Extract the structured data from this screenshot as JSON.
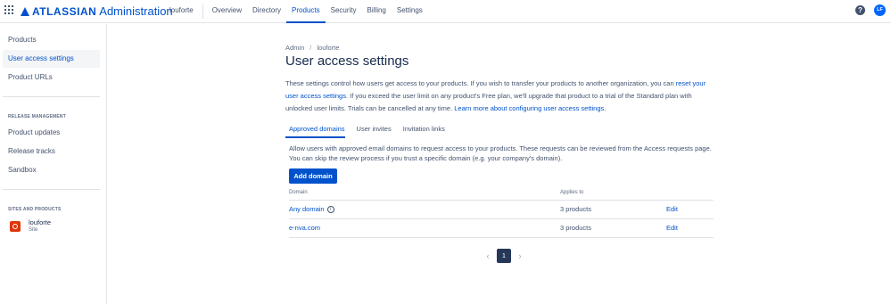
{
  "topbar": {
    "logo_word": "ATLASSIAN",
    "logo_product": "Administration",
    "org": "louforte",
    "nav": [
      "Overview",
      "Directory",
      "Products",
      "Security",
      "Billing",
      "Settings"
    ],
    "active_nav": "Products",
    "help_label": "?",
    "avatar_initials": "LF"
  },
  "sidebar": {
    "items": [
      "Products",
      "User access settings",
      "Product URLs"
    ],
    "selected": "User access settings",
    "release_heading": "RELEASE MANAGEMENT",
    "release_items": [
      "Product updates",
      "Release tracks",
      "Sandbox"
    ],
    "sites_heading": "SITES AND PRODUCTS",
    "site_name": "louforte",
    "site_sub": "Site"
  },
  "main": {
    "breadcrumb": [
      "Admin",
      "louforte"
    ],
    "title": "User access settings",
    "desc_part1": "These settings control how users get access to your products. If you wish to transfer your products to another organization, you can ",
    "desc_link1": "reset your user access settings",
    "desc_part2": ". If you exceed the user limit on any product's Free plan, we'll upgrade that product to a trial of the Standard plan with unlocked user limits. Trials can be cancelled at any time. ",
    "desc_link2": "Learn more about configuring user access settings.",
    "tabs": [
      "Approved domains",
      "User invites",
      "Invitation links"
    ],
    "active_tab": "Approved domains",
    "tab_desc": "Allow users with approved email domains to request access to your products. These requests can be reviewed from the Access requests page. You can skip the review process if you trust a specific domain (e.g. your company's domain).",
    "add_button": "Add domain",
    "table": {
      "headers": [
        "Domain",
        "Applies to"
      ],
      "rows": [
        {
          "domain": "Any domain",
          "applies": "3 products",
          "action": "Edit"
        },
        {
          "domain": "e-nva.com",
          "applies": "3 products",
          "action": "Edit"
        }
      ]
    },
    "pagination": {
      "current": "1"
    }
  }
}
